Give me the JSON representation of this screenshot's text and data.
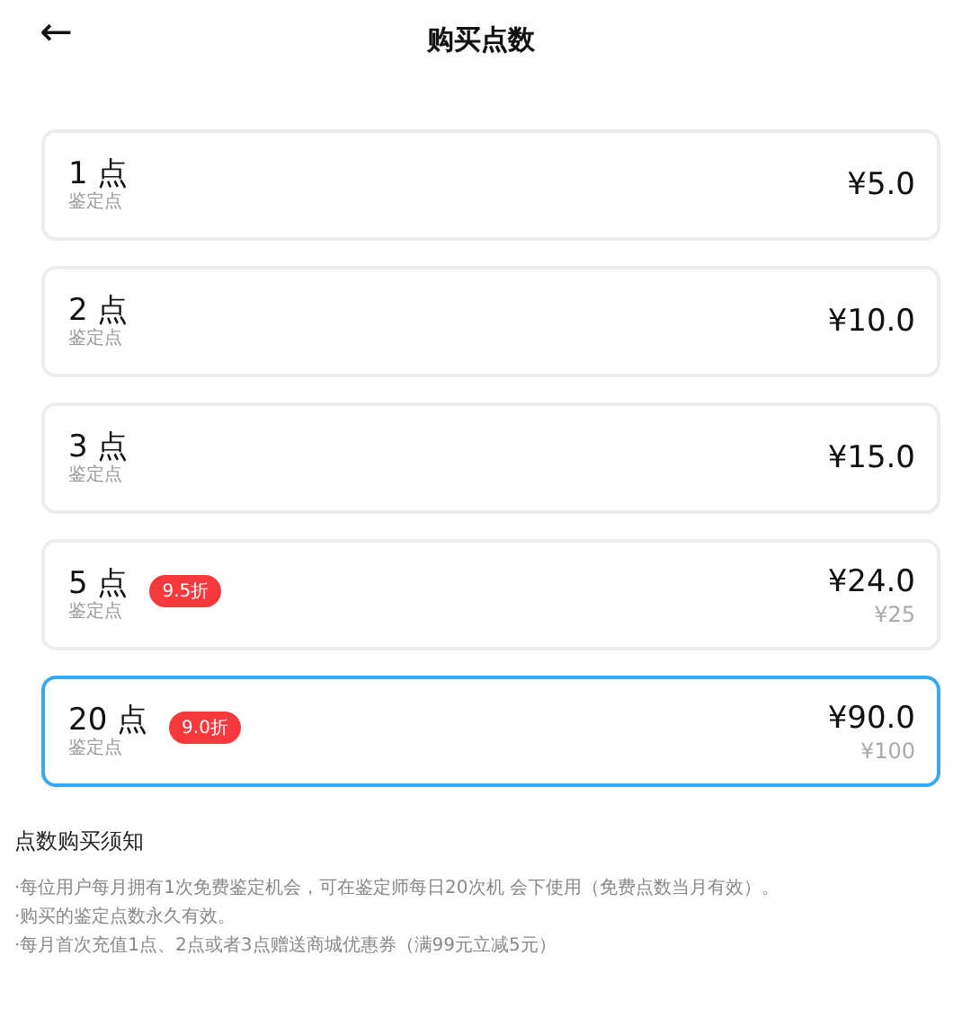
{
  "header": {
    "back": "←",
    "title": "购买点数"
  },
  "packages": [
    {
      "points": "1 点",
      "unit": "鉴定点",
      "price": "¥5.0",
      "selected": false
    },
    {
      "points": "2 点",
      "unit": "鉴定点",
      "price": "¥10.0",
      "selected": false
    },
    {
      "points": "3 点",
      "unit": "鉴定点",
      "price": "¥15.0",
      "selected": false
    },
    {
      "points": "5 点",
      "unit": "鉴定点",
      "discount": "9.5折",
      "price": "¥24.0",
      "original_price": "¥25",
      "selected": false
    },
    {
      "points": "20 点",
      "unit": "鉴定点",
      "discount": "9.0折",
      "price": "¥90.0",
      "original_price": "¥100",
      "selected": true
    }
  ],
  "notice": {
    "title": "点数购买须知",
    "lines": [
      "·每位用户每月拥有1次免费鉴定机会，可在鉴定师每日20次机 会下使用（免费点数当月有效）。",
      "·购买的鉴定点数永久有效。",
      "·每月首次充值1点、2点或者3点赠送商城优惠券（满99元立减5元）"
    ]
  }
}
